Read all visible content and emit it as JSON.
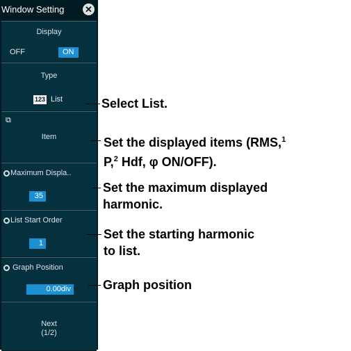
{
  "window_title": "Window Setting",
  "display": {
    "label": "Display",
    "off": "OFF",
    "on": "ON"
  },
  "type": {
    "label": "Type",
    "icon_text": "123",
    "value": "List"
  },
  "item": {
    "label": "Item"
  },
  "max_display": {
    "label": "Maximum Displa..",
    "value": "35"
  },
  "list_start": {
    "label": "List Start Order",
    "value": "1"
  },
  "graph_position": {
    "label": "Graph Position",
    "value": "0.00div"
  },
  "next": {
    "line1": "Next",
    "line2": "(1/2)"
  },
  "callouts": {
    "select_list": "Select List.",
    "items_line1_a": "Set the displayed items (RMS,",
    "items_line1_sup": "1",
    "items_line2_a": "P,",
    "items_line2_sup": "2",
    "items_line2_b": " Hdf, φ ON/OFF).",
    "max_line1": "Set the maximum displayed",
    "max_line2": "harmonic.",
    "start_line1": "Set the starting harmonic",
    "start_line2": "to list.",
    "graph": "Graph position"
  },
  "colors": {
    "panel": "#001a22",
    "section": "#05303d",
    "accent": "#1d8fd3"
  }
}
